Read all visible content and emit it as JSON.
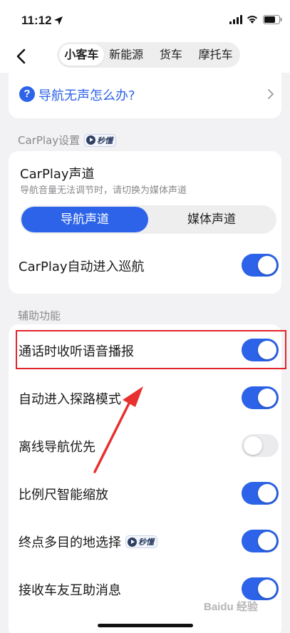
{
  "status_bar": {
    "time": "11:12"
  },
  "nav": {
    "tabs": [
      {
        "label": "小客车",
        "active": true
      },
      {
        "label": "新能源",
        "active": false
      },
      {
        "label": "货车",
        "active": false
      },
      {
        "label": "摩托车",
        "active": false
      }
    ]
  },
  "help": {
    "icon": "?",
    "text": "导航无声怎么办?"
  },
  "carplay_section": {
    "label": "CarPlay设置",
    "badge": "秒懂"
  },
  "carplay": {
    "title": "CarPlay声道",
    "description": "导航音量无法调节时，请切换为媒体声道",
    "channel_options": [
      {
        "label": "导航声道",
        "active": true
      },
      {
        "label": "媒体声道",
        "active": false
      }
    ],
    "auto_cruise": {
      "label": "CarPlay自动进入巡航",
      "on": true
    }
  },
  "assist_section": {
    "label": "辅助功能"
  },
  "assist_rows": [
    {
      "label": "通话时收听语音播报",
      "on": true
    },
    {
      "label": "自动进入探路模式",
      "on": true
    },
    {
      "label": "离线导航优先",
      "on": false
    },
    {
      "label": "比例尺智能缩放",
      "on": true
    },
    {
      "label": "终点多目的地选择",
      "on": true,
      "badge": "秒懂"
    },
    {
      "label": "接收车友互助消息",
      "on": true
    }
  ],
  "bottom_partial": "",
  "watermark": "Baidu 经验",
  "colors": {
    "accent": "#2c63e8",
    "highlight": "#e2242a",
    "toggle_off": "#ebebed"
  }
}
